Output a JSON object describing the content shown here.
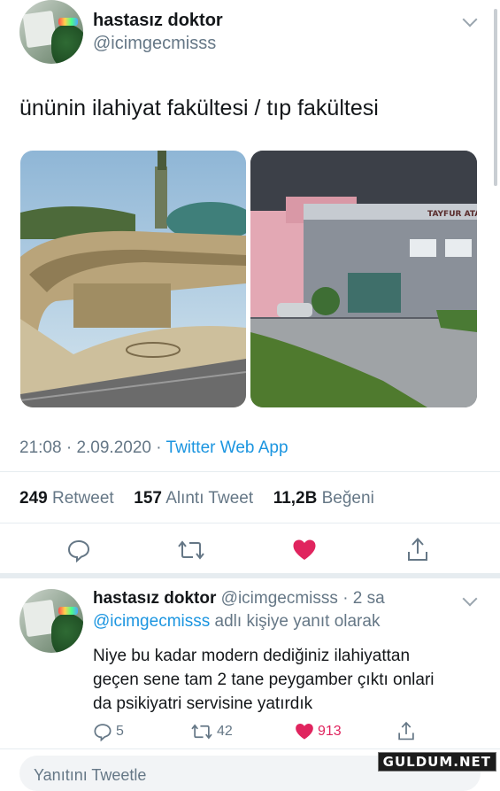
{
  "tweet": {
    "author_name": "hastasız doktor",
    "author_handle": "@icimgecmisss",
    "text": "ününin ilahiyat fakültesi / tıp fakültesi",
    "photo_right_sign": "TAYFUR ATA",
    "time": "21:08",
    "date": "2.09.2020",
    "source": "Twitter Web App",
    "retweets_count": "249",
    "retweets_label": "Retweet",
    "quotes_count": "157",
    "quotes_label": "Alıntı Tweet",
    "likes_count": "11,2B",
    "likes_label": "Beğeni"
  },
  "reply": {
    "author_name": "hastasız doktor",
    "author_handle": "@icimgecmisss",
    "time_ago": "· 2 sa",
    "reply_to_handle": "@icimgecmisss",
    "reply_to_suffix": "adlı kişiye yanıt olarak",
    "text_line1": "Niye bu kadar modern dediğiniz ilahiyattan",
    "text_line2": "geçen sene tam 2 tane peygamber çıktı onlari",
    "text_line3": "da psikiyatri servisine yatırdık",
    "reply_count": "5",
    "retweet_count": "42",
    "like_count": "913"
  },
  "compose_placeholder": "Yanıtını Tweetle",
  "watermark": "GULDUM.NET",
  "colors": {
    "accent": "#1b95e0",
    "like": "#e0245e",
    "muted": "#657786"
  }
}
